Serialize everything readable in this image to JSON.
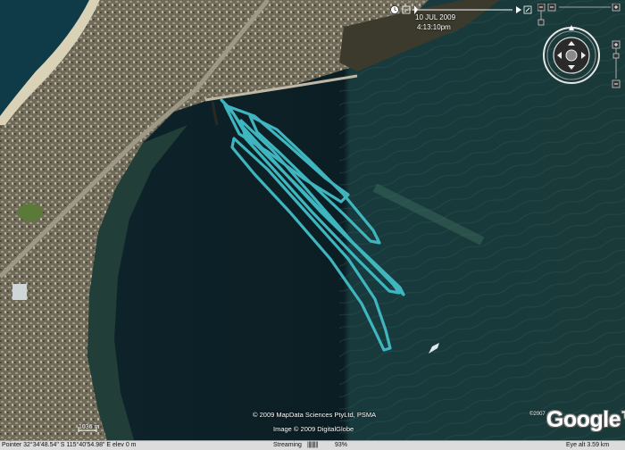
{
  "time_slider": {
    "date": "10 JUL 2009",
    "time": "4:13:10pm"
  },
  "attribution": {
    "line1": "© 2009 MapData Sciences PtyLtd, PSMA",
    "line2": "Image © 2009 DigitalGlobe",
    "google_copyright": "©2007",
    "google_logo": "Google™"
  },
  "scale": {
    "label": "1036 m"
  },
  "status_bar": {
    "pointer": "Pointer  32°34'48.54\" S   115°40'54.98\" E   elev   0 m",
    "streaming_label": "Streaming",
    "streaming_bar": "|||||||||",
    "streaming_percent": "93%",
    "eye_alt": "Eye alt    3.59 km"
  },
  "colors": {
    "track": "#3fb6bf",
    "water_deep": "#0a1e26",
    "water_shallow": "#1f4548",
    "land": "#6a6550"
  }
}
